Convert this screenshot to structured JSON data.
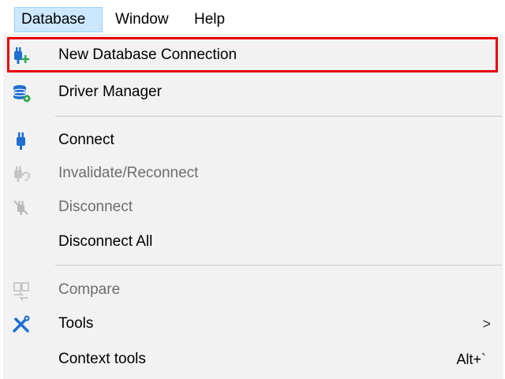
{
  "menubar": {
    "items": [
      {
        "label": "Database"
      },
      {
        "label": "Window"
      },
      {
        "label": "Help"
      }
    ]
  },
  "menu": {
    "items": [
      {
        "label": "New Database Connection",
        "enabled": true,
        "icon": "plug-plus-icon"
      },
      {
        "label": "Driver Manager",
        "enabled": true,
        "icon": "database-gear-icon"
      },
      {
        "label": "Connect",
        "enabled": true,
        "icon": "plug-icon"
      },
      {
        "label": "Invalidate/Reconnect",
        "enabled": false,
        "icon": "plug-refresh-icon"
      },
      {
        "label": "Disconnect",
        "enabled": false,
        "icon": "unplug-icon"
      },
      {
        "label": "Disconnect All",
        "enabled": true
      },
      {
        "label": "Compare",
        "enabled": false,
        "icon": "compare-icon"
      },
      {
        "label": "Tools",
        "enabled": true,
        "icon": "tools-icon",
        "submenu_arrow": ">"
      },
      {
        "label": "Context tools",
        "enabled": true,
        "shortcut": "Alt+`"
      }
    ]
  },
  "colors": {
    "highlight_border": "#e8000c",
    "menu_background": "#f2f2f2",
    "active_menubar_bg": "#cce8ff",
    "icon_blue": "#1f6fd0",
    "icon_green": "#2fa84f"
  }
}
